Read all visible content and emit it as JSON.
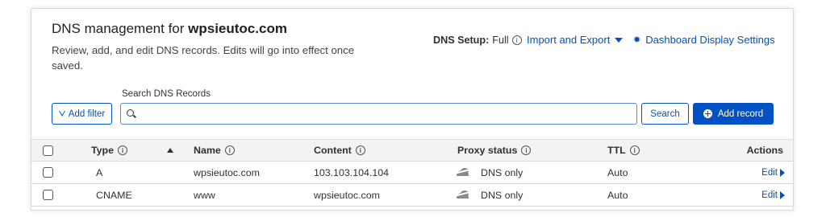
{
  "header": {
    "title_prefix": "DNS management for",
    "domain": "wpsieutoc.com",
    "description": "Review, add, and edit DNS records. Edits will go into effect once saved."
  },
  "setup": {
    "label": "DNS Setup:",
    "value": "Full"
  },
  "links": {
    "import_export": "Import and Export",
    "dashboard_settings": "Dashboard Display Settings"
  },
  "search": {
    "label": "Search DNS Records",
    "value": "",
    "placeholder": "",
    "add_filter": "Add filter",
    "search_button": "Search",
    "add_record": "Add record"
  },
  "table": {
    "columns": {
      "type": "Type",
      "name": "Name",
      "content": "Content",
      "proxy": "Proxy status",
      "ttl": "TTL",
      "actions": "Actions"
    },
    "rows": [
      {
        "type": "A",
        "name": "wpsieutoc.com",
        "content": "103.103.104.104",
        "proxy": "DNS only",
        "ttl": "Auto",
        "action": "Edit"
      },
      {
        "type": "CNAME",
        "name": "www",
        "content": "wpsieutoc.com",
        "proxy": "DNS only",
        "ttl": "Auto",
        "action": "Edit"
      }
    ]
  },
  "colors": {
    "accent": "#0051c3",
    "text": "#313131",
    "header_bg": "#f3f3f3",
    "cloud_grey": "#8a8a8a"
  },
  "icons": {
    "info": "info-circle-icon",
    "caret": "caret-down-icon",
    "gear": "gear-icon",
    "filter": "filter-icon",
    "search": "search-icon",
    "add": "plus-circle-icon",
    "sort": "sort-up-icon",
    "proxy": "cloud-dns-only-icon",
    "edit": "caret-right-icon"
  }
}
